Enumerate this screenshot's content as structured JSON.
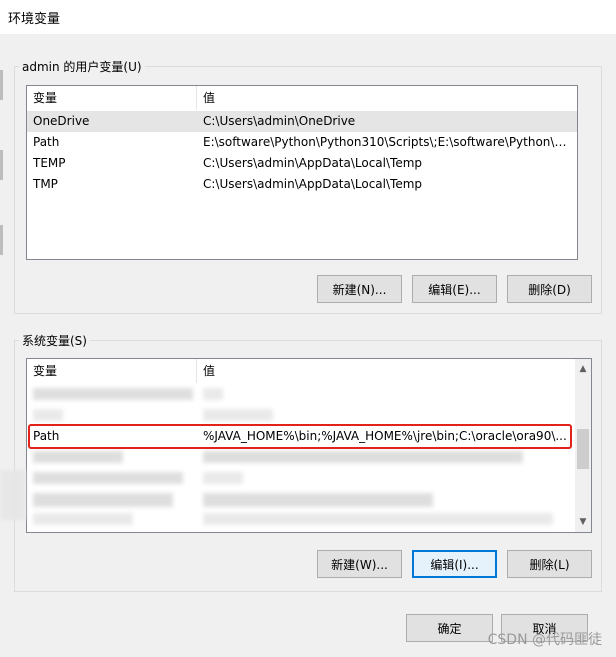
{
  "window": {
    "title": "环境变量"
  },
  "user_vars": {
    "label": "admin 的用户变量(U)",
    "columns": [
      "变量",
      "值"
    ],
    "rows": [
      {
        "name": "OneDrive",
        "value": "C:\\Users\\admin\\OneDrive"
      },
      {
        "name": "Path",
        "value": "E:\\software\\Python\\Python310\\Scripts\\;E:\\software\\Python\\Pyt..."
      },
      {
        "name": "TEMP",
        "value": "C:\\Users\\admin\\AppData\\Local\\Temp"
      },
      {
        "name": "TMP",
        "value": "C:\\Users\\admin\\AppData\\Local\\Temp"
      }
    ],
    "buttons": {
      "new": "新建(N)...",
      "edit": "编辑(E)...",
      "delete": "删除(D)"
    }
  },
  "system_vars": {
    "label": "系统变量(S)",
    "columns": [
      "变量",
      "值"
    ],
    "highlighted_row": {
      "name": "Path",
      "value": "%JAVA_HOME%\\bin;%JAVA_HOME%\\jre\\bin;C:\\oracle\\ora90\\..."
    },
    "buttons": {
      "new": "新建(W)...",
      "edit": "编辑(I)...",
      "delete": "删除(L)"
    }
  },
  "dialog_buttons": {
    "ok": "确定",
    "cancel": "取消"
  },
  "watermark": "CSDN @代码匪徒",
  "colors": {
    "highlight_border": "#e2231a",
    "focus_border": "#0078d7"
  }
}
